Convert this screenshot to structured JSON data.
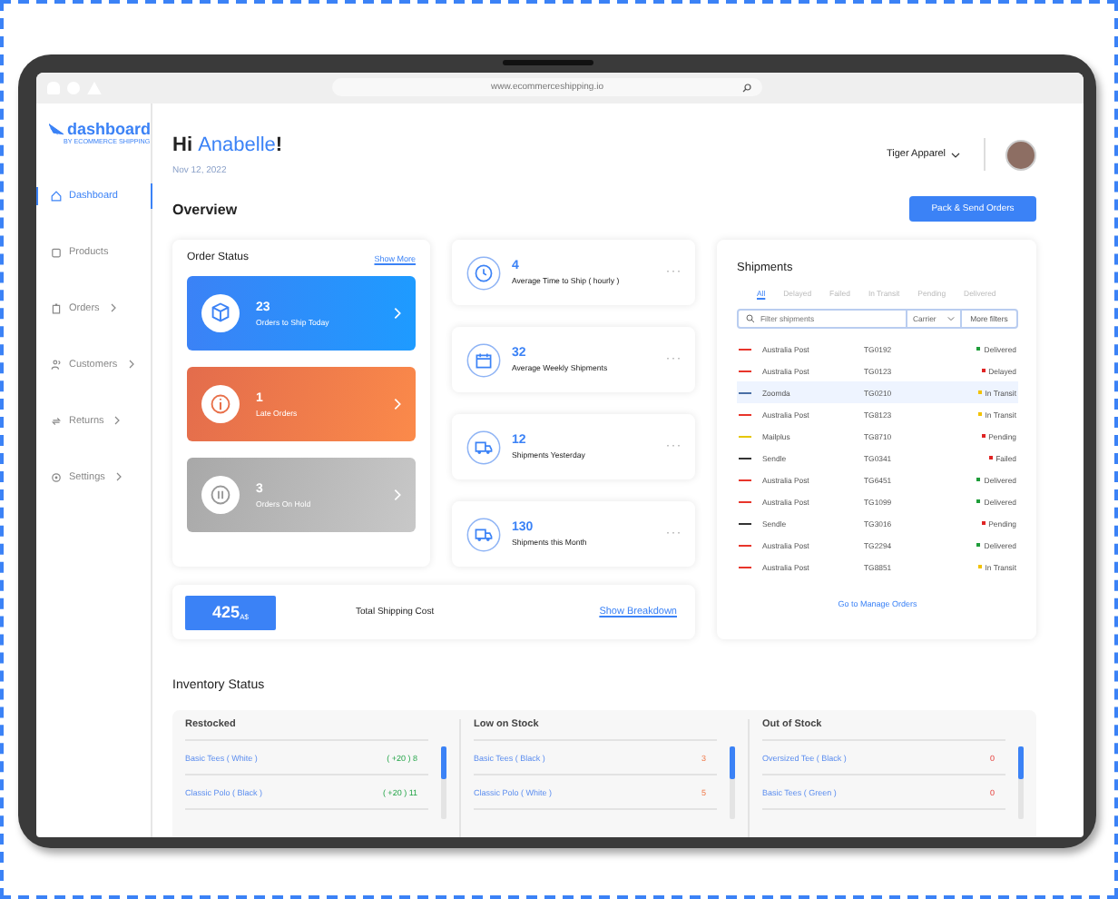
{
  "browser": {
    "url": "www.ecommerceshipping.io"
  },
  "brand": {
    "name": "dashboard",
    "tagline": "BY ECOMMERCE SHIPPING"
  },
  "sidebar": {
    "items": [
      {
        "kind": "home",
        "label": "Dashboard",
        "expandable": false,
        "selected": true
      },
      {
        "kind": "box",
        "label": "Products",
        "expandable": false,
        "selected": false
      },
      {
        "kind": "clipboard",
        "label": "Orders",
        "expandable": true,
        "selected": false
      },
      {
        "kind": "people",
        "label": "Customers",
        "expandable": true,
        "selected": false
      },
      {
        "kind": "returns",
        "label": "Returns",
        "expandable": true,
        "selected": false
      },
      {
        "kind": "gear",
        "label": "Settings",
        "expandable": true,
        "selected": false
      }
    ]
  },
  "header": {
    "greeting": "Hi",
    "name": "Anabelle",
    "punct": "!",
    "date": "Nov 12, 2022",
    "store": "Tiger Apparel"
  },
  "overview": {
    "title": "Overview",
    "action": "Pack & Send Orders"
  },
  "order_status": {
    "title": "Order Status",
    "link": "Show More",
    "tiles": [
      {
        "kind": "ship",
        "count": "23",
        "label": "Orders to Ship Today"
      },
      {
        "kind": "late",
        "count": "1",
        "label": "Late Orders"
      },
      {
        "kind": "hold",
        "count": "3",
        "label": "Orders On Hold"
      }
    ]
  },
  "stats": [
    {
      "kind": "clock",
      "value": "4",
      "label": "Average Time to Ship ( hourly )",
      "more": "···"
    },
    {
      "kind": "calendar",
      "value": "32",
      "label": "Average Weekly Shipments",
      "more": "···"
    },
    {
      "kind": "truck",
      "value": "12",
      "label": "Shipments Yesterday",
      "more": "···"
    },
    {
      "kind": "truck",
      "value": "130",
      "label": "Shipments this Month",
      "more": "···"
    }
  ],
  "shipping_cost": {
    "value": "425",
    "unit": "A$",
    "label": "Total Shipping Cost",
    "link": "Show Breakdown"
  },
  "shipments": {
    "title": "Shipments",
    "tabs": [
      {
        "label": "All",
        "selected": true
      },
      {
        "label": "Delayed",
        "selected": false
      },
      {
        "label": "Failed",
        "selected": false
      },
      {
        "label": "In Transit",
        "selected": false
      },
      {
        "label": "Pending",
        "selected": false
      },
      {
        "label": "Delivered",
        "selected": false
      }
    ],
    "search": {
      "placeholder": "Filter shipments"
    },
    "carrier_filter": "Carrier",
    "more_filters": "More filters",
    "rows": [
      {
        "kind": "auspost",
        "carrier": "Australia Post",
        "tracking": "TG0192",
        "status": "Delivered",
        "color": "#1f9d3a",
        "selected": false
      },
      {
        "kind": "auspost",
        "carrier": "Australia Post",
        "tracking": "TG0123",
        "status": "Delayed",
        "color": "#e02424",
        "selected": false
      },
      {
        "kind": "zoomda",
        "carrier": "Zoomda",
        "tracking": "TG0210",
        "status": "In Transit",
        "color": "#f2c200",
        "selected": true
      },
      {
        "kind": "auspost",
        "carrier": "Australia Post",
        "tracking": "TG8123",
        "status": "In Transit",
        "color": "#f2c200",
        "selected": false
      },
      {
        "kind": "mailplus",
        "carrier": "Mailplus",
        "tracking": "TG8710",
        "status": "Pending",
        "color": "#e02424",
        "selected": false
      },
      {
        "kind": "sendle",
        "carrier": "Sendle",
        "tracking": "TG0341",
        "status": "Failed",
        "color": "#e02424",
        "selected": false
      },
      {
        "kind": "auspost",
        "carrier": "Australia Post",
        "tracking": "TG6451",
        "status": "Delivered",
        "color": "#1f9d3a",
        "selected": false
      },
      {
        "kind": "auspost",
        "carrier": "Australia Post",
        "tracking": "TG1099",
        "status": "Delivered",
        "color": "#1f9d3a",
        "selected": false
      },
      {
        "kind": "sendle",
        "carrier": "Sendle",
        "tracking": "TG3016",
        "status": "Pending",
        "color": "#e02424",
        "selected": false
      },
      {
        "kind": "auspost",
        "carrier": "Australia Post",
        "tracking": "TG2294",
        "status": "Delivered",
        "color": "#1f9d3a",
        "selected": false
      },
      {
        "kind": "auspost",
        "carrier": "Australia Post",
        "tracking": "TG8851",
        "status": "In Transit",
        "color": "#f2c200",
        "selected": false
      }
    ],
    "link": "Go to Manage Orders"
  },
  "inventory": {
    "title": "Inventory Status",
    "columns": [
      {
        "kind": "restocked",
        "title": "Restocked",
        "items": [
          {
            "name": "Basic Tees ( White )",
            "qty": "( +20 ) 8"
          },
          {
            "name": "Classic Polo ( Black )",
            "qty": "( +20 ) 11"
          }
        ]
      },
      {
        "kind": "low",
        "title": "Low on Stock",
        "items": [
          {
            "name": "Basic Tees ( Black )",
            "qty": "3"
          },
          {
            "name": "Classic Polo ( White )",
            "qty": "5"
          }
        ]
      },
      {
        "kind": "out",
        "title": "Out of Stock",
        "items": [
          {
            "name": "Oversized Tee ( Black )",
            "qty": "0"
          },
          {
            "name": "Basic Tees ( Green )",
            "qty": "0"
          }
        ]
      }
    ]
  }
}
